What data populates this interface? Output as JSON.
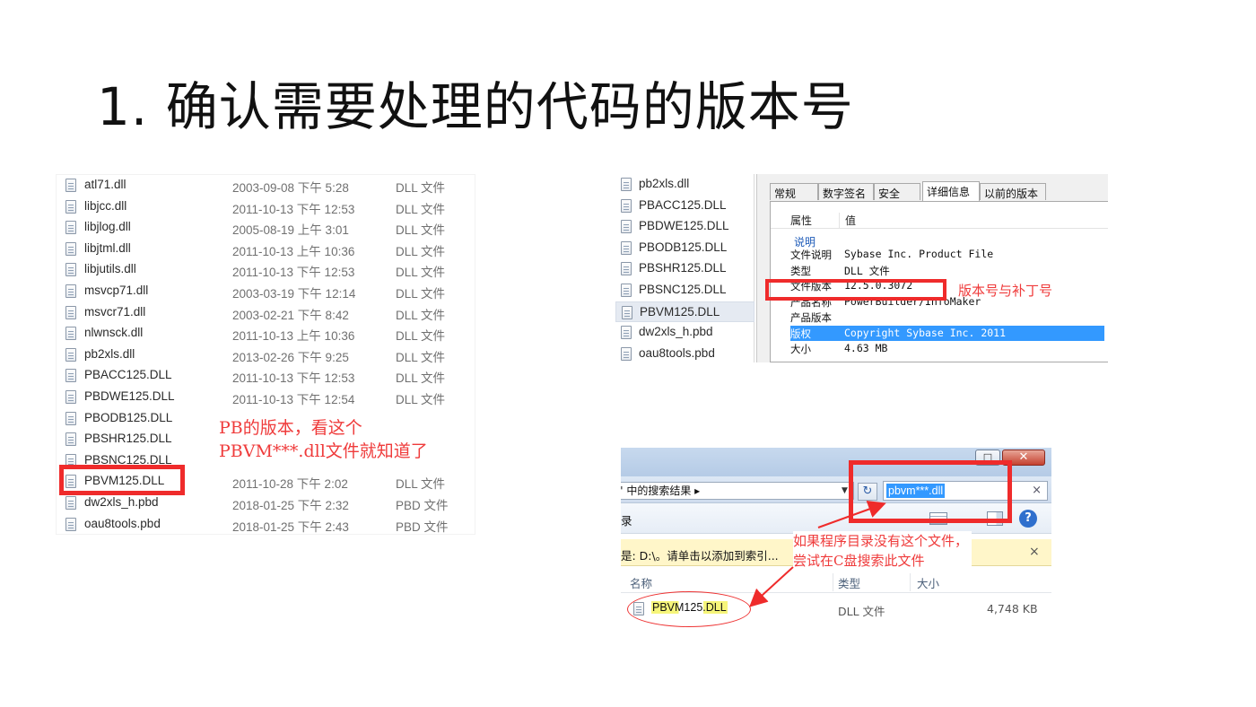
{
  "slide_title": "1. 确认需要处理的代码的版本号",
  "colors": {
    "annotation_red": "#ef2b2b",
    "highlight_yellow": "#f6f57a",
    "selection_blue": "#3399ff"
  },
  "panel1": {
    "files": [
      {
        "name": "atl71.dll",
        "date": "2003-09-08 下午 5:28",
        "type": "DLL 文件"
      },
      {
        "name": "libjcc.dll",
        "date": "2011-10-13 下午 12:53",
        "type": "DLL 文件"
      },
      {
        "name": "libjlog.dll",
        "date": "2005-08-19 上午 3:01",
        "type": "DLL 文件"
      },
      {
        "name": "libjtml.dll",
        "date": "2011-10-13 上午 10:36",
        "type": "DLL 文件"
      },
      {
        "name": "libjutils.dll",
        "date": "2011-10-13 下午 12:53",
        "type": "DLL 文件"
      },
      {
        "name": "msvcp71.dll",
        "date": "2003-03-19 下午 12:14",
        "type": "DLL 文件"
      },
      {
        "name": "msvcr71.dll",
        "date": "2003-02-21 下午 8:42",
        "type": "DLL 文件"
      },
      {
        "name": "nlwnsck.dll",
        "date": "2011-10-13 上午 10:36",
        "type": "DLL 文件"
      },
      {
        "name": "pb2xls.dll",
        "date": "2013-02-26 下午 9:25",
        "type": "DLL 文件"
      },
      {
        "name": "PBACC125.DLL",
        "date": "2011-10-13 下午 12:53",
        "type": "DLL 文件"
      },
      {
        "name": "PBDWE125.DLL",
        "date": "2011-10-13 下午 12:54",
        "type": "DLL 文件"
      },
      {
        "name": "PBODB125.DLL",
        "date": "",
        "type": ""
      },
      {
        "name": "PBSHR125.DLL",
        "date": "",
        "type": ""
      },
      {
        "name": "PBSNC125.DLL",
        "date": "",
        "type": ""
      },
      {
        "name": "PBVM125.DLL",
        "date": "2011-10-28 下午 2:02",
        "type": "DLL 文件"
      },
      {
        "name": "dw2xls_h.pbd",
        "date": "2018-01-25 下午 2:32",
        "type": "PBD 文件"
      },
      {
        "name": "oau8tools.pbd",
        "date": "2018-01-25 下午 2:43",
        "type": "PBD 文件"
      }
    ],
    "annotation_line1": "PB的版本，看这个",
    "annotation_line2": "PBVM***.dll文件就知道了"
  },
  "panel2": {
    "files": [
      "pb2xls.dll",
      "PBACC125.DLL",
      "PBDWE125.DLL",
      "PBODB125.DLL",
      "PBSHR125.DLL",
      "PBSNC125.DLL",
      "PBVM125.DLL",
      "dw2xls_h.pbd",
      "oau8tools.pbd"
    ],
    "tabs": [
      "常规",
      "数字签名",
      "安全",
      "详细信息",
      "以前的版本"
    ],
    "header_property": "属性",
    "header_value": "值",
    "section_label": "说明",
    "rows": [
      {
        "key": "文件说明",
        "value": "Sybase Inc. Product File"
      },
      {
        "key": "类型",
        "value": "DLL 文件"
      },
      {
        "key": "文件版本",
        "value": "12.5.0.3072"
      },
      {
        "key": "产品名称",
        "value": "PowerBuilder/InfoMaker"
      },
      {
        "key": "产品版本",
        "value": ""
      },
      {
        "key": "版权",
        "value": "Copyright Sybase Inc. 2011"
      },
      {
        "key": "大小",
        "value": "4.63 MB"
      }
    ],
    "annotation": "版本号与补丁号"
  },
  "panel3": {
    "max_button": "□",
    "close_button": "✕",
    "address": "\" 中的搜索结果 ▸",
    "search_value": "pbvm***.dll",
    "search_clear": "×",
    "toolbar_label": "录",
    "infobar_text": "是: D:\\。请单击以添加到索引...",
    "infobar_close": "×",
    "col_name": "名称",
    "col_type": "类型",
    "col_size": "大小",
    "result_name": "PBVM125.DLL",
    "result_type": "DLL 文件",
    "result_size": "4,748 KB",
    "annotation_line1": "如果程序目录没有这个文件，",
    "annotation_line2": "尝试在C盘搜索此文件"
  }
}
